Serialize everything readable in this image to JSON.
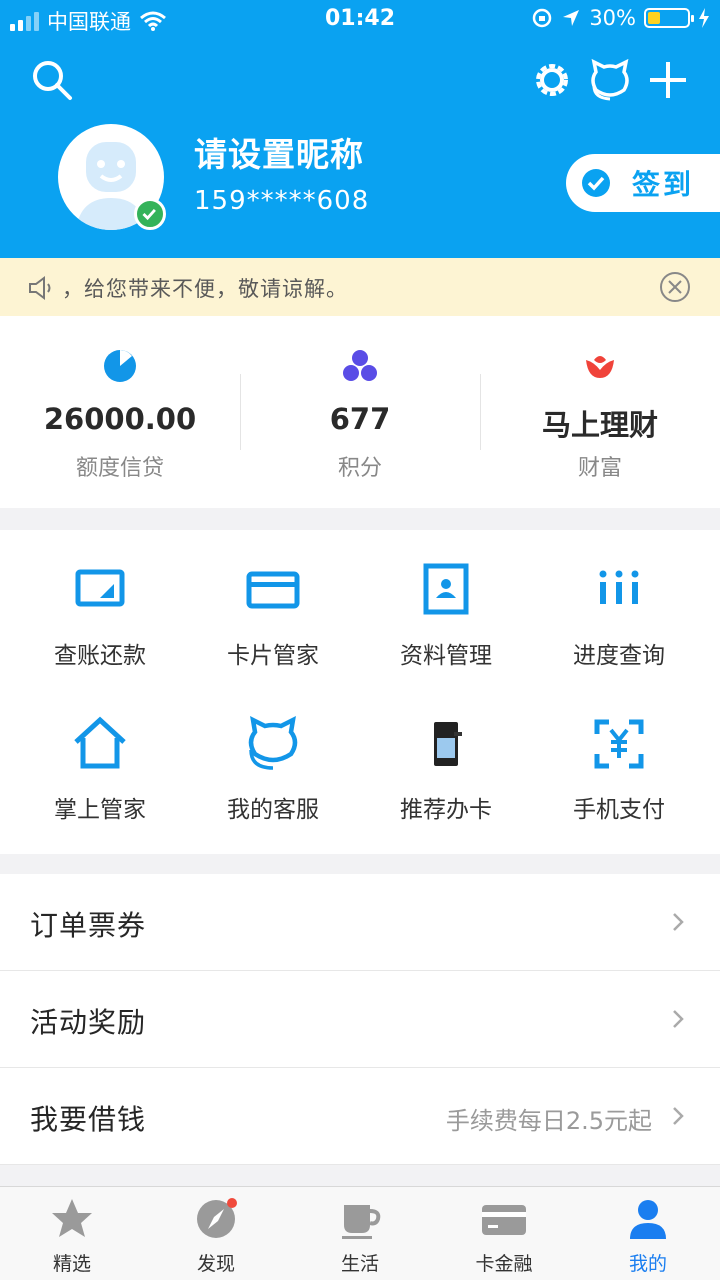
{
  "status_bar": {
    "carrier": "中国联通",
    "time": "01:42",
    "battery": "30%"
  },
  "header": {
    "nickname": "请设置昵称",
    "phone": "159*****608",
    "signin_label": "签到"
  },
  "notice": {
    "text": "，给您带来不便，敬请谅解。"
  },
  "stats": [
    {
      "value": "26000.00",
      "label": "额度信贷",
      "icon": "pie-icon"
    },
    {
      "value": "677",
      "label": "积分",
      "icon": "dots-icon"
    },
    {
      "value": "马上理财",
      "label": "财富",
      "icon": "lotus-icon"
    }
  ],
  "grid": [
    {
      "label": "查账还款",
      "icon": "bill-icon"
    },
    {
      "label": "卡片管家",
      "icon": "card-icon"
    },
    {
      "label": "资料管理",
      "icon": "profile-icon"
    },
    {
      "label": "进度查询",
      "icon": "progress-icon"
    },
    {
      "label": "掌上管家",
      "icon": "home-icon"
    },
    {
      "label": "我的客服",
      "icon": "service-icon"
    },
    {
      "label": "推荐办卡",
      "icon": "water-dispenser-icon"
    },
    {
      "label": "手机支付",
      "icon": "scan-pay-icon"
    }
  ],
  "list": [
    {
      "label": "订单票券",
      "detail": ""
    },
    {
      "label": "活动奖励",
      "detail": ""
    },
    {
      "label": "我要借钱",
      "detail": "手续费每日2.5元起"
    }
  ],
  "tabs": [
    {
      "label": "精选",
      "icon": "star-icon"
    },
    {
      "label": "发现",
      "icon": "compass-icon"
    },
    {
      "label": "生活",
      "icon": "cup-icon"
    },
    {
      "label": "卡金融",
      "icon": "card-icon"
    },
    {
      "label": "我的",
      "icon": "person-icon"
    }
  ],
  "colors": {
    "brand": "#0aa2f1",
    "notice_bg": "#fdf4d3",
    "tab_active": "#1a7ef0",
    "verified": "#34b35a"
  }
}
